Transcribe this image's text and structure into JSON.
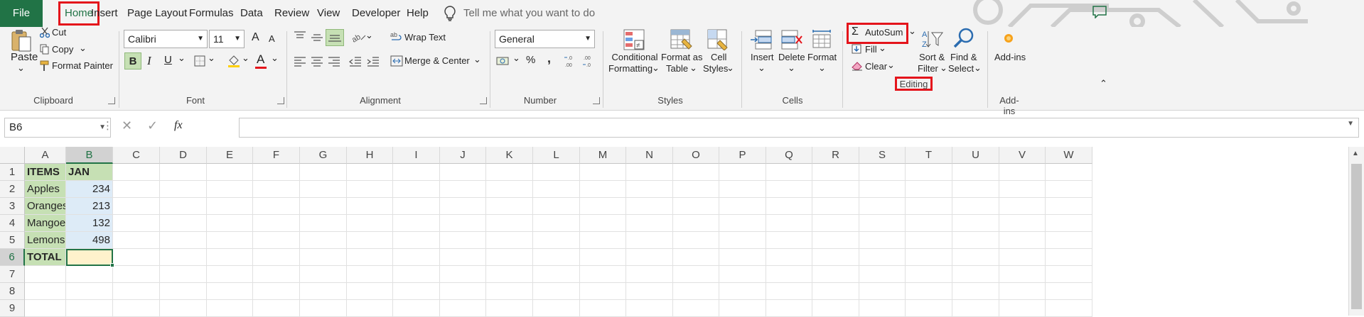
{
  "tabs": {
    "file": "File",
    "home": "Home",
    "insert": "Insert",
    "page_layout": "Page Layout",
    "formulas": "Formulas",
    "data": "Data",
    "review": "Review",
    "view": "View",
    "developer": "Developer",
    "help": "Help",
    "tell_me": "Tell me what you want to do"
  },
  "clipboard": {
    "paste": "Paste",
    "cut": "Cut",
    "copy": "Copy",
    "format_painter": "Format Painter",
    "group": "Clipboard"
  },
  "font": {
    "name": "Calibri",
    "size": "11",
    "bold": "B",
    "italic": "I",
    "underline": "U",
    "font_color_glyph": "A",
    "grow_glyph": "A",
    "shrink_glyph": "A",
    "group": "Font"
  },
  "alignment": {
    "wrap_text": "Wrap Text",
    "merge_center": "Merge & Center",
    "group": "Alignment"
  },
  "number": {
    "format": "General",
    "percent": "%",
    "comma": ",",
    "group": "Number"
  },
  "styles": {
    "conditional_formatting": [
      "Conditional",
      "Formatting"
    ],
    "format_as_table": [
      "Format as",
      "Table"
    ],
    "cell_styles": [
      "Cell",
      "Styles"
    ],
    "group": "Styles"
  },
  "cells": {
    "insert": "Insert",
    "delete": "Delete",
    "format": "Format",
    "group": "Cells"
  },
  "editing": {
    "autosum": "AutoSum",
    "fill": "Fill",
    "clear": "Clear",
    "sort_filter": [
      "Sort &",
      "Filter"
    ],
    "find_select": [
      "Find &",
      "Select"
    ],
    "group": "Editing"
  },
  "addins": {
    "label": "Add-ins",
    "group": "Add-ins"
  },
  "formula_bar": {
    "name_box": "B6",
    "fx": "fx",
    "formula": ""
  },
  "sheet": {
    "columns": [
      "A",
      "B",
      "C",
      "D",
      "E",
      "F",
      "G",
      "H",
      "I",
      "J",
      "K",
      "L",
      "M",
      "N",
      "O",
      "P",
      "Q",
      "R",
      "S",
      "T",
      "U",
      "V",
      "W"
    ],
    "rows": [
      "1",
      "2",
      "3",
      "4",
      "5",
      "6",
      "7",
      "8",
      "9"
    ],
    "header_items": "ITEMS",
    "header_jan": "JAN",
    "items": [
      {
        "name": "Apples",
        "jan": "234"
      },
      {
        "name": "Oranges",
        "jan": "213"
      },
      {
        "name": "Mangoes",
        "jan": "132"
      },
      {
        "name": "Lemons",
        "jan": "498"
      }
    ],
    "total_label": "TOTAL",
    "total_value": ""
  },
  "colors": {
    "accent": "#217346",
    "highlight": "#e4141b",
    "header_fill": "#c6e0b4",
    "value_fill": "#ddebf7",
    "total_fill": "#fff2cc"
  }
}
